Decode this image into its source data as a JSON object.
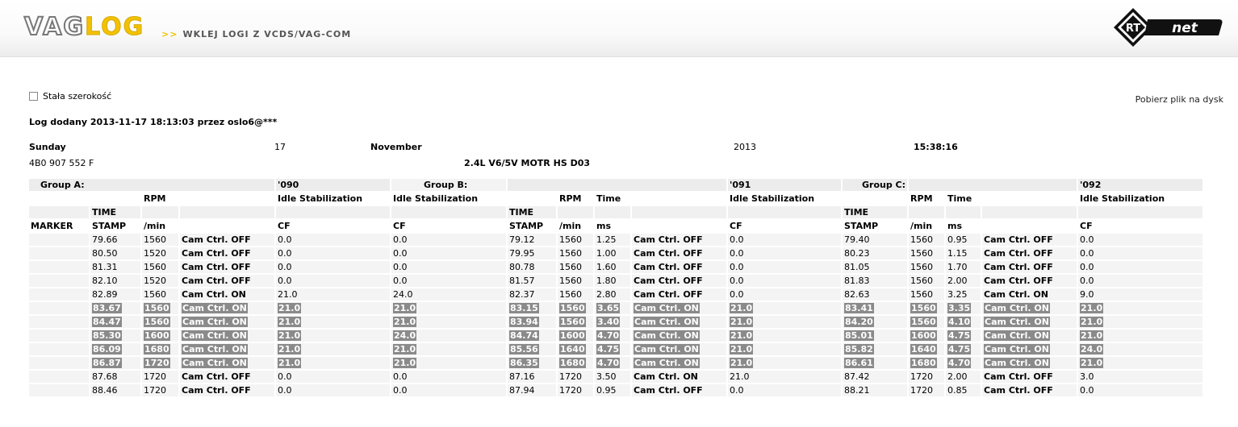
{
  "header": {
    "logo_vag": "VAG",
    "logo_log": "LOG",
    "slogan_arrows": ">>",
    "slogan": "WKLEJ LOGI Z VCDS/VAG-COM",
    "brand_rt": "RT",
    "brand_net": "net"
  },
  "options": {
    "fixed_width_label": "Stała szerokość",
    "download_label": "Pobierz plik na dysk"
  },
  "added": "Log dodany 2013-11-17 18:13:03 przez oslo6@***",
  "meta": {
    "weekday": "Sunday",
    "day": "17",
    "month": "November",
    "year": "2013",
    "time": "15:38:16",
    "part_number": "4B0 907 552 F",
    "engine": "2.4L V6/5V MOTR HS D03"
  },
  "groups": [
    {
      "label": "Group A:",
      "code": "'090"
    },
    {
      "label": "Group B:",
      "code": "'091"
    },
    {
      "label": "Group C:",
      "code": "'092"
    }
  ],
  "head_row1": [
    "",
    "",
    "RPM",
    "",
    "Idle Stabilization",
    "Idle Stabilization",
    "",
    "RPM",
    "Time",
    "",
    "Idle Stabilization",
    "",
    "",
    "RPM",
    "Time",
    "",
    "Idle Stabilization"
  ],
  "head_row2": [
    "",
    "TIME",
    "",
    "",
    "",
    "",
    "TIME",
    "",
    "",
    "",
    "",
    "TIME",
    "",
    "",
    "",
    "",
    ""
  ],
  "head_row3": [
    "MARKER",
    "STAMP",
    "/min",
    "",
    "CF",
    "CF",
    "STAMP",
    "/min",
    "ms",
    "",
    "CF",
    "STAMP",
    "/min",
    "ms",
    "",
    "CF",
    ""
  ],
  "rows": [
    [
      "",
      "79.66",
      "1560",
      "Cam Ctrl. OFF",
      "0.0",
      "0.0",
      "79.12",
      "1560",
      "1.25",
      "Cam Ctrl. OFF",
      "0.0",
      "79.40",
      "1560",
      "0.95",
      "Cam Ctrl. OFF",
      "0.0"
    ],
    [
      "",
      "80.50",
      "1520",
      "Cam Ctrl. OFF",
      "0.0",
      "0.0",
      "79.95",
      "1560",
      "1.00",
      "Cam Ctrl. OFF",
      "0.0",
      "80.23",
      "1560",
      "1.15",
      "Cam Ctrl. OFF",
      "0.0"
    ],
    [
      "",
      "81.31",
      "1560",
      "Cam Ctrl. OFF",
      "0.0",
      "0.0",
      "80.78",
      "1560",
      "1.60",
      "Cam Ctrl. OFF",
      "0.0",
      "81.05",
      "1560",
      "1.70",
      "Cam Ctrl. OFF",
      "0.0"
    ],
    [
      "",
      "82.10",
      "1520",
      "Cam Ctrl. OFF",
      "0.0",
      "0.0",
      "81.57",
      "1560",
      "1.80",
      "Cam Ctrl. OFF",
      "0.0",
      "81.83",
      "1560",
      "2.00",
      "Cam Ctrl. OFF",
      "0.0"
    ],
    [
      "",
      "82.89",
      "1560",
      "Cam Ctrl. ON",
      "21.0",
      "24.0",
      "82.37",
      "1560",
      "2.80",
      "Cam Ctrl. OFF",
      "0.0",
      "82.63",
      "1560",
      "3.25",
      "Cam Ctrl. ON",
      "9.0"
    ],
    [
      "",
      "83.67",
      "1560",
      "Cam Ctrl. ON",
      "21.0",
      "21.0",
      "83.15",
      "1560",
      "3.65",
      "Cam Ctrl. ON",
      "21.0",
      "83.41",
      "1560",
      "3.35",
      "Cam Ctrl. ON",
      "21.0"
    ],
    [
      "",
      "84.47",
      "1560",
      "Cam Ctrl. ON",
      "21.0",
      "21.0",
      "83.94",
      "1560",
      "3.40",
      "Cam Ctrl. ON",
      "21.0",
      "84.20",
      "1560",
      "4.10",
      "Cam Ctrl. ON",
      "21.0"
    ],
    [
      "",
      "85.30",
      "1600",
      "Cam Ctrl. ON",
      "21.0",
      "24.0",
      "84.74",
      "1600",
      "4.70",
      "Cam Ctrl. ON",
      "21.0",
      "85.01",
      "1600",
      "4.75",
      "Cam Ctrl. ON",
      "21.0"
    ],
    [
      "",
      "86.09",
      "1680",
      "Cam Ctrl. ON",
      "21.0",
      "21.0",
      "85.56",
      "1640",
      "4.75",
      "Cam Ctrl. ON",
      "21.0",
      "85.82",
      "1640",
      "4.75",
      "Cam Ctrl. ON",
      "24.0"
    ],
    [
      "",
      "86.87",
      "1720",
      "Cam Ctrl. ON",
      "21.0",
      "21.0",
      "86.35",
      "1680",
      "4.70",
      "Cam Ctrl. ON",
      "21.0",
      "86.61",
      "1680",
      "4.70",
      "Cam Ctrl. ON",
      "21.0"
    ],
    [
      "",
      "87.68",
      "1720",
      "Cam Ctrl. OFF",
      "0.0",
      "0.0",
      "87.16",
      "1720",
      "3.50",
      "Cam Ctrl. ON",
      "21.0",
      "87.42",
      "1720",
      "2.00",
      "Cam Ctrl. OFF",
      "3.0"
    ],
    [
      "",
      "88.46",
      "1720",
      "Cam Ctrl. OFF",
      "0.0",
      "0.0",
      "87.94",
      "1720",
      "0.95",
      "Cam Ctrl. OFF",
      "0.0",
      "88.21",
      "1720",
      "0.85",
      "Cam Ctrl. OFF",
      "0.0"
    ]
  ],
  "highlighted_rows": [
    5,
    6,
    7,
    8,
    9
  ],
  "colors": {
    "logo_yellow": "#f2c200",
    "highlight_bg": "#8a8a8a",
    "row_bg": "#f4f4f4"
  }
}
